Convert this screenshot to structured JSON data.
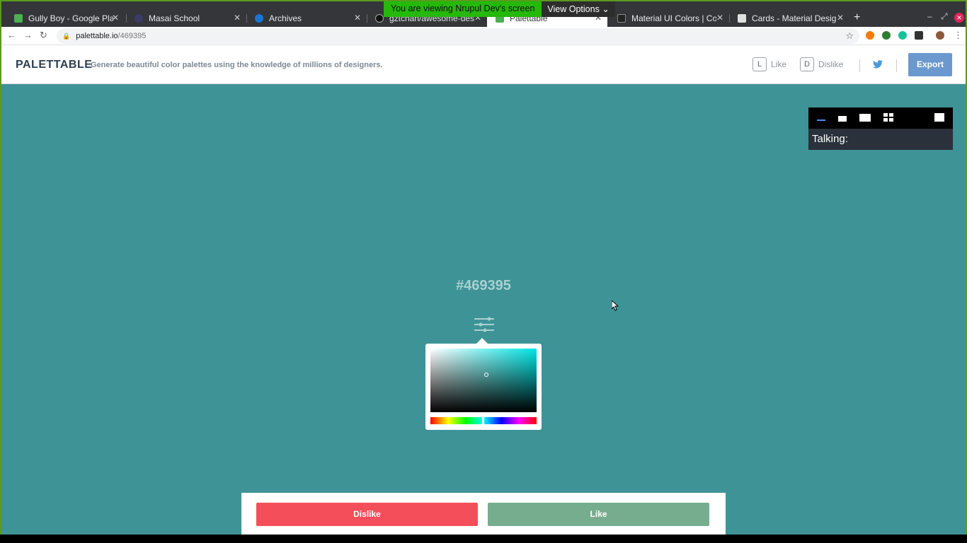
{
  "share_banner": {
    "message": "You are viewing Nrupul Dev's screen",
    "options": "View Options"
  },
  "tabs": [
    {
      "title": "Gully Boy - Google Play M",
      "color": "#4caf50"
    },
    {
      "title": "Masai School",
      "color": "#2c2c54"
    },
    {
      "title": "Archives",
      "color": "#1976d2"
    },
    {
      "title": "gztchan/awesome-design",
      "color": "#24292e"
    },
    {
      "title": "Palettable",
      "color": "#4caf50"
    },
    {
      "title": "Material UI Colors | Colo",
      "color": "#222"
    },
    {
      "title": "Cards - Material Design",
      "color": "#e0e0e0"
    }
  ],
  "address": {
    "domain": "palettable.io",
    "path": "/469395"
  },
  "app": {
    "logo": "PALETTABLE",
    "tagline": "Generate beautiful color palettes using the knowledge of millions of designers.",
    "like_key": "L",
    "like_label": "Like",
    "dislike_key": "D",
    "dislike_label": "Dislike",
    "export_label": "Export"
  },
  "canvas": {
    "background": "#3e9397",
    "hex": "#469395",
    "picker_hue_color": "#00e5e5"
  },
  "meeting_panel": {
    "talking_label": "Talking:"
  },
  "actions": {
    "dislike": "Dislike",
    "like": "Like",
    "dislike_color": "#f44e5a",
    "like_color": "#76ad8e"
  }
}
